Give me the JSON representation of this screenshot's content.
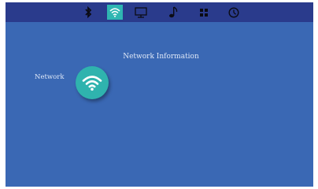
{
  "tabs": [
    {
      "icon": "bluetooth-icon",
      "active": false
    },
    {
      "icon": "wifi-icon",
      "active": true
    },
    {
      "icon": "display-icon",
      "active": false
    },
    {
      "icon": "music-icon",
      "active": false
    },
    {
      "icon": "apps-icon",
      "active": false
    },
    {
      "icon": "clock-icon",
      "active": false
    }
  ],
  "main": {
    "section_title": "Network Information",
    "network_label": "Network"
  },
  "colors": {
    "background": "#3a68b4",
    "topbar": "#2a3b8c",
    "accent": "#2fb6b2"
  }
}
